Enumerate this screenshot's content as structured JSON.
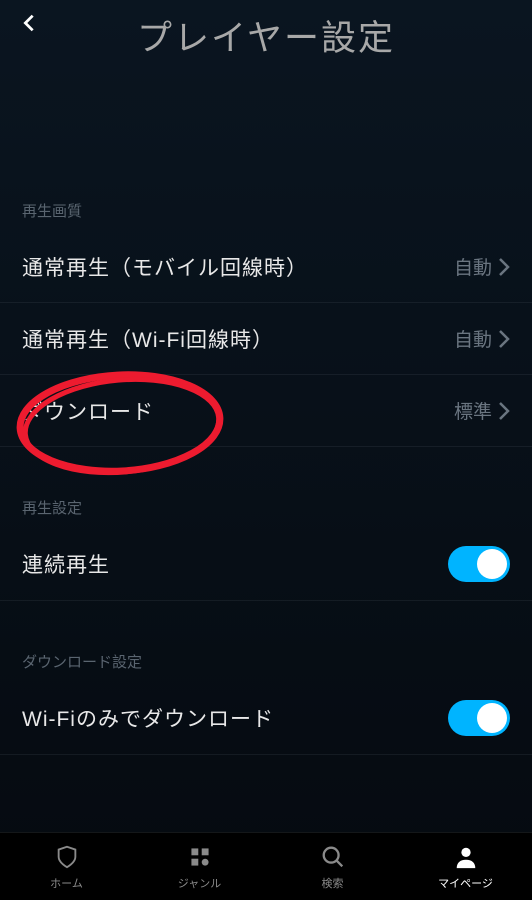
{
  "header": {
    "title": "プレイヤー設定"
  },
  "sections": {
    "playback_quality": {
      "label": "再生画質",
      "items": [
        {
          "label": "通常再生（モバイル回線時）",
          "value": "自動"
        },
        {
          "label": "通常再生（Wi-Fi回線時）",
          "value": "自動"
        },
        {
          "label": "ダウンロード",
          "value": "標準"
        }
      ]
    },
    "playback_settings": {
      "label": "再生設定",
      "items": [
        {
          "label": "連続再生",
          "toggle": true
        }
      ]
    },
    "download_settings": {
      "label": "ダウンロード設定",
      "items": [
        {
          "label": "Wi-Fiのみでダウンロード",
          "toggle": true
        }
      ]
    }
  },
  "tabbar": {
    "items": [
      {
        "label": "ホーム"
      },
      {
        "label": "ジャンル"
      },
      {
        "label": "検索"
      },
      {
        "label": "マイページ"
      }
    ],
    "active": 3
  },
  "colors": {
    "accent": "#00b4ff",
    "annotation": "#ed1b2f"
  }
}
